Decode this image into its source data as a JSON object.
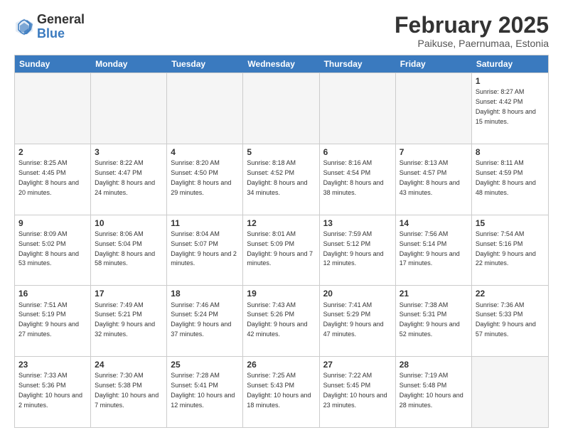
{
  "header": {
    "logo_general": "General",
    "logo_blue": "Blue",
    "title": "February 2025",
    "location": "Paikuse, Paernumaa, Estonia"
  },
  "days_of_week": [
    "Sunday",
    "Monday",
    "Tuesday",
    "Wednesday",
    "Thursday",
    "Friday",
    "Saturday"
  ],
  "weeks": [
    [
      {
        "day": "",
        "info": ""
      },
      {
        "day": "",
        "info": ""
      },
      {
        "day": "",
        "info": ""
      },
      {
        "day": "",
        "info": ""
      },
      {
        "day": "",
        "info": ""
      },
      {
        "day": "",
        "info": ""
      },
      {
        "day": "1",
        "info": "Sunrise: 8:27 AM\nSunset: 4:42 PM\nDaylight: 8 hours and 15 minutes."
      }
    ],
    [
      {
        "day": "2",
        "info": "Sunrise: 8:25 AM\nSunset: 4:45 PM\nDaylight: 8 hours and 20 minutes."
      },
      {
        "day": "3",
        "info": "Sunrise: 8:22 AM\nSunset: 4:47 PM\nDaylight: 8 hours and 24 minutes."
      },
      {
        "day": "4",
        "info": "Sunrise: 8:20 AM\nSunset: 4:50 PM\nDaylight: 8 hours and 29 minutes."
      },
      {
        "day": "5",
        "info": "Sunrise: 8:18 AM\nSunset: 4:52 PM\nDaylight: 8 hours and 34 minutes."
      },
      {
        "day": "6",
        "info": "Sunrise: 8:16 AM\nSunset: 4:54 PM\nDaylight: 8 hours and 38 minutes."
      },
      {
        "day": "7",
        "info": "Sunrise: 8:13 AM\nSunset: 4:57 PM\nDaylight: 8 hours and 43 minutes."
      },
      {
        "day": "8",
        "info": "Sunrise: 8:11 AM\nSunset: 4:59 PM\nDaylight: 8 hours and 48 minutes."
      }
    ],
    [
      {
        "day": "9",
        "info": "Sunrise: 8:09 AM\nSunset: 5:02 PM\nDaylight: 8 hours and 53 minutes."
      },
      {
        "day": "10",
        "info": "Sunrise: 8:06 AM\nSunset: 5:04 PM\nDaylight: 8 hours and 58 minutes."
      },
      {
        "day": "11",
        "info": "Sunrise: 8:04 AM\nSunset: 5:07 PM\nDaylight: 9 hours and 2 minutes."
      },
      {
        "day": "12",
        "info": "Sunrise: 8:01 AM\nSunset: 5:09 PM\nDaylight: 9 hours and 7 minutes."
      },
      {
        "day": "13",
        "info": "Sunrise: 7:59 AM\nSunset: 5:12 PM\nDaylight: 9 hours and 12 minutes."
      },
      {
        "day": "14",
        "info": "Sunrise: 7:56 AM\nSunset: 5:14 PM\nDaylight: 9 hours and 17 minutes."
      },
      {
        "day": "15",
        "info": "Sunrise: 7:54 AM\nSunset: 5:16 PM\nDaylight: 9 hours and 22 minutes."
      }
    ],
    [
      {
        "day": "16",
        "info": "Sunrise: 7:51 AM\nSunset: 5:19 PM\nDaylight: 9 hours and 27 minutes."
      },
      {
        "day": "17",
        "info": "Sunrise: 7:49 AM\nSunset: 5:21 PM\nDaylight: 9 hours and 32 minutes."
      },
      {
        "day": "18",
        "info": "Sunrise: 7:46 AM\nSunset: 5:24 PM\nDaylight: 9 hours and 37 minutes."
      },
      {
        "day": "19",
        "info": "Sunrise: 7:43 AM\nSunset: 5:26 PM\nDaylight: 9 hours and 42 minutes."
      },
      {
        "day": "20",
        "info": "Sunrise: 7:41 AM\nSunset: 5:29 PM\nDaylight: 9 hours and 47 minutes."
      },
      {
        "day": "21",
        "info": "Sunrise: 7:38 AM\nSunset: 5:31 PM\nDaylight: 9 hours and 52 minutes."
      },
      {
        "day": "22",
        "info": "Sunrise: 7:36 AM\nSunset: 5:33 PM\nDaylight: 9 hours and 57 minutes."
      }
    ],
    [
      {
        "day": "23",
        "info": "Sunrise: 7:33 AM\nSunset: 5:36 PM\nDaylight: 10 hours and 2 minutes."
      },
      {
        "day": "24",
        "info": "Sunrise: 7:30 AM\nSunset: 5:38 PM\nDaylight: 10 hours and 7 minutes."
      },
      {
        "day": "25",
        "info": "Sunrise: 7:28 AM\nSunset: 5:41 PM\nDaylight: 10 hours and 12 minutes."
      },
      {
        "day": "26",
        "info": "Sunrise: 7:25 AM\nSunset: 5:43 PM\nDaylight: 10 hours and 18 minutes."
      },
      {
        "day": "27",
        "info": "Sunrise: 7:22 AM\nSunset: 5:45 PM\nDaylight: 10 hours and 23 minutes."
      },
      {
        "day": "28",
        "info": "Sunrise: 7:19 AM\nSunset: 5:48 PM\nDaylight: 10 hours and 28 minutes."
      },
      {
        "day": "",
        "info": ""
      }
    ]
  ]
}
